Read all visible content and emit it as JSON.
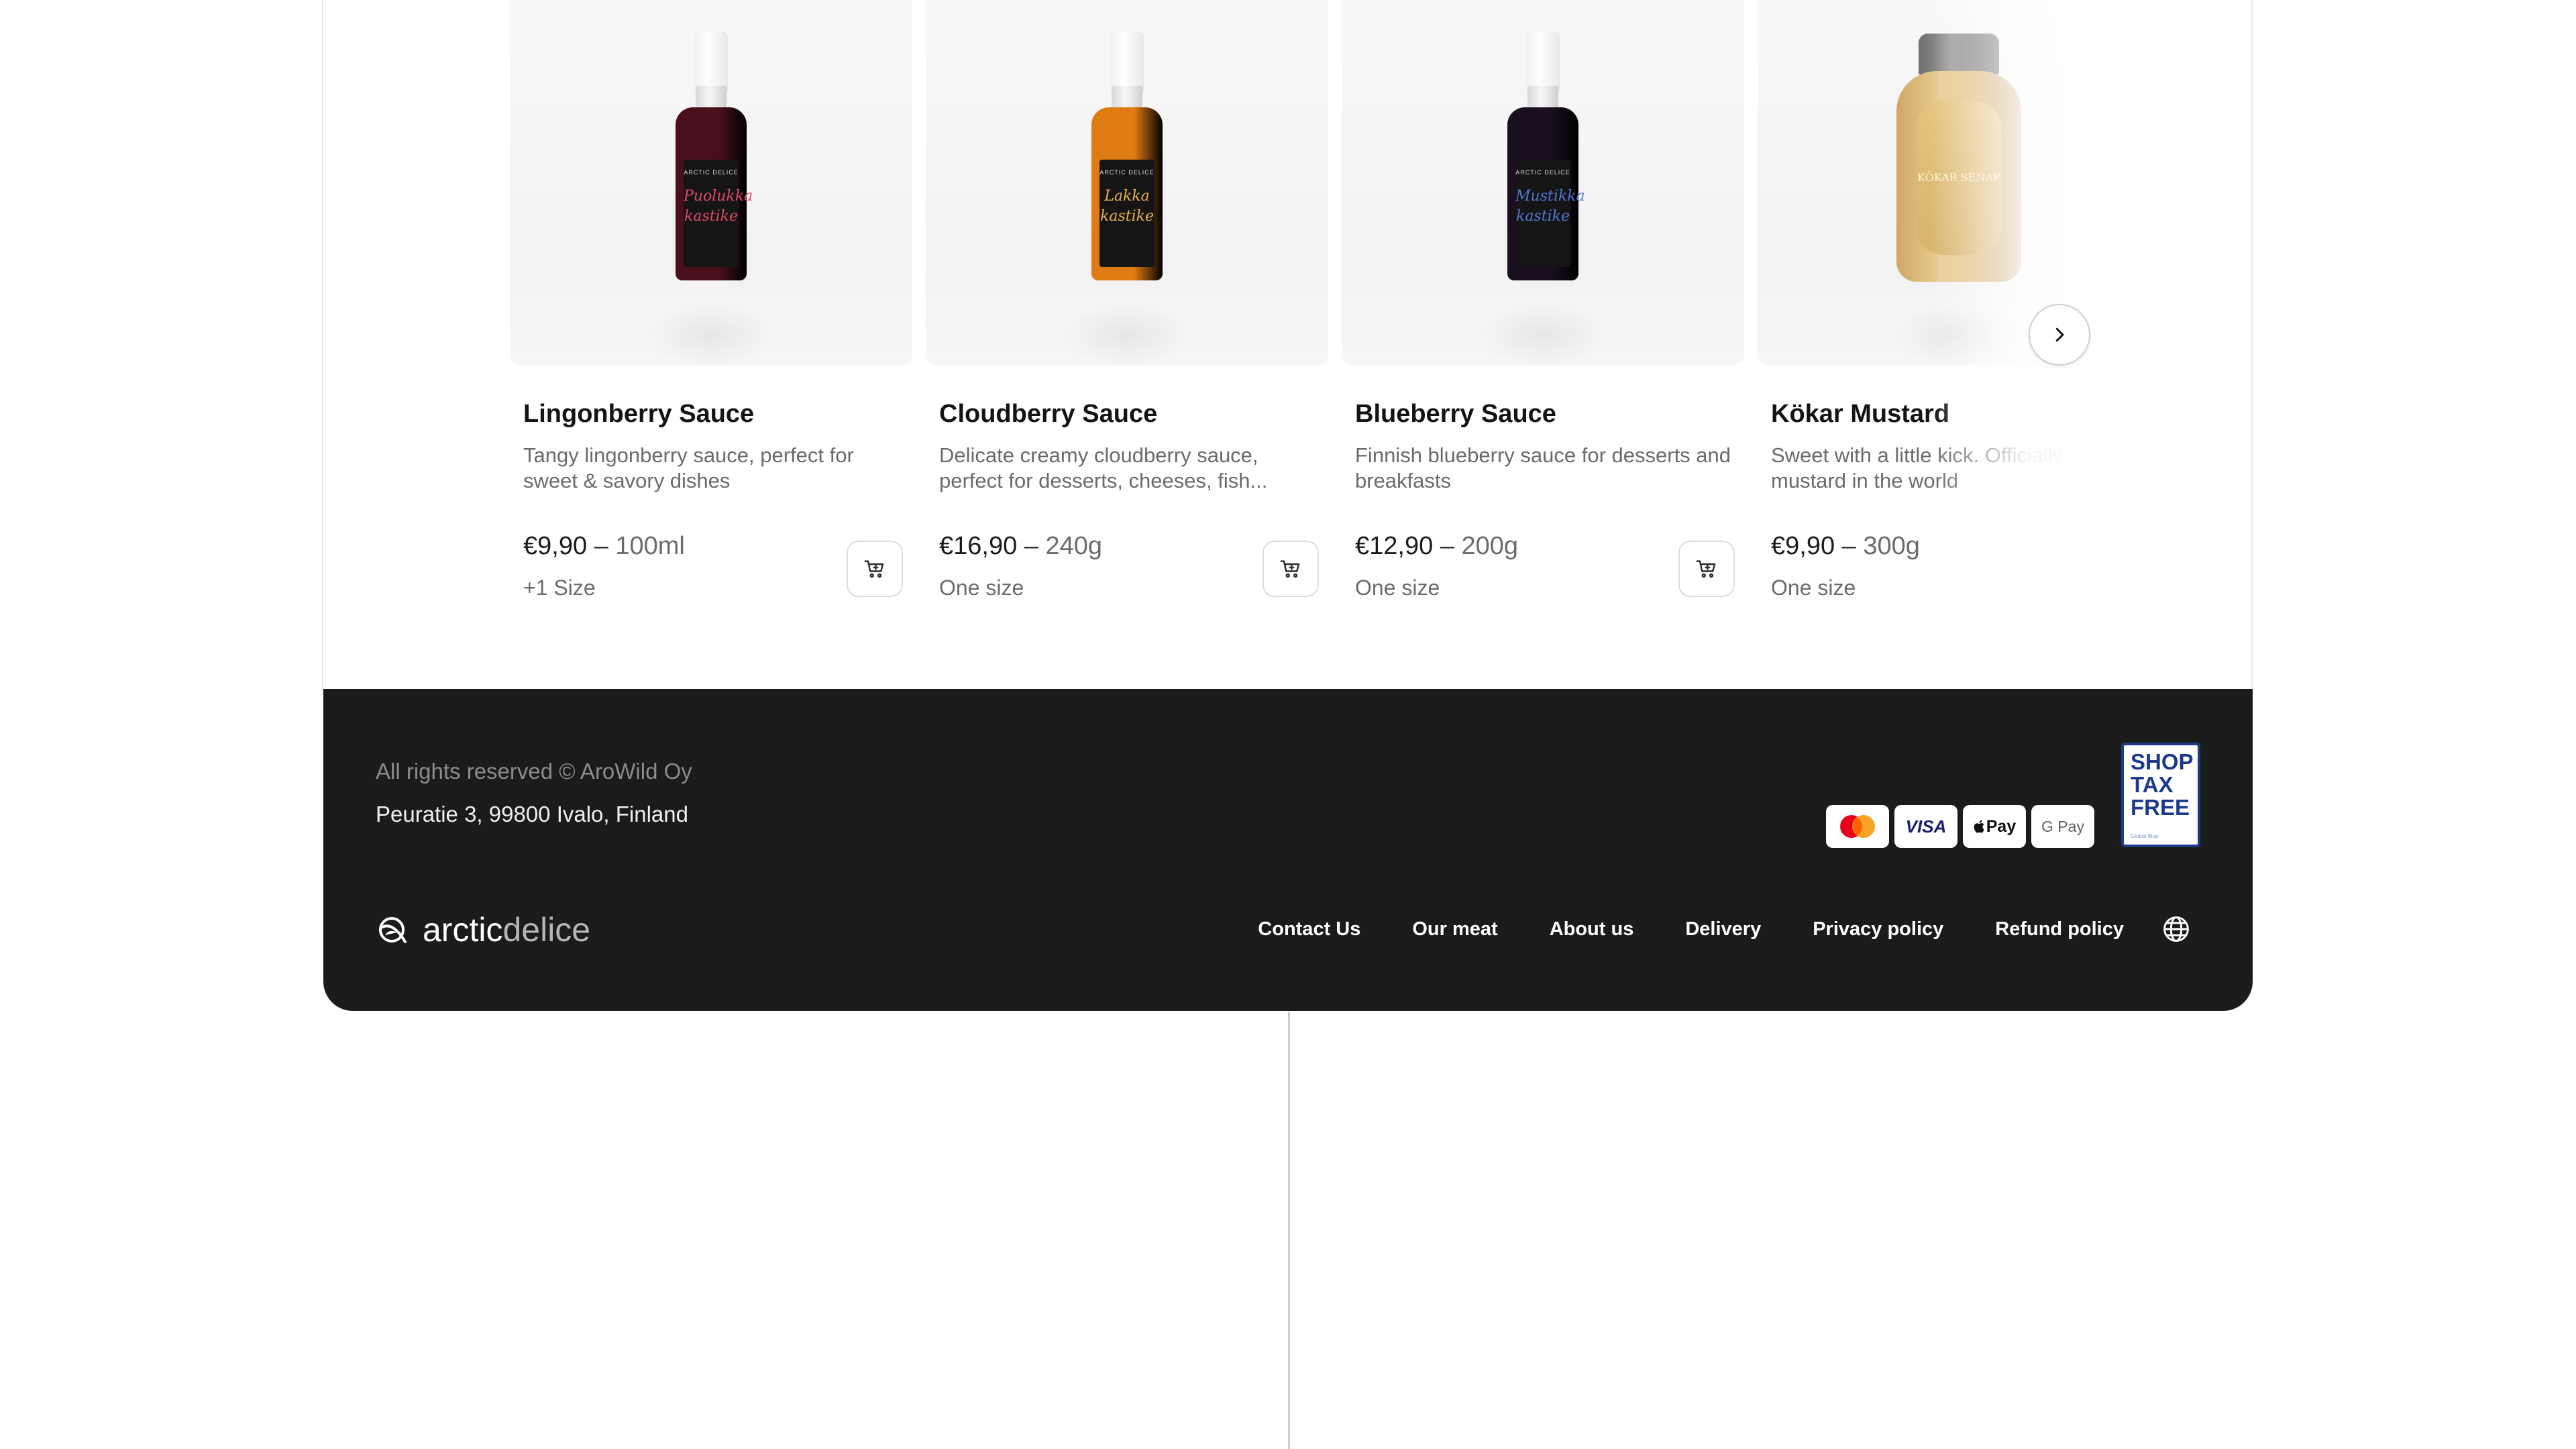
{
  "products": [
    {
      "name": "Lingonberry Sauce",
      "description": "Tangy lingonberry sauce, perfect for sweet & savory dishes",
      "price": "€9,90",
      "size": "100ml",
      "variant": "+1 Size",
      "label_brand": "ARCTIC DELICE",
      "label_script": "Puolukka kastike",
      "liquid_color": "#4a0f1c",
      "script_color": "#e0486a"
    },
    {
      "name": "Cloudberry Sauce",
      "description": "Delicate creamy cloudberry sauce, perfect for desserts, cheeses, fish...",
      "price": "€16,90",
      "size": "240g",
      "variant": "One size",
      "label_brand": "ARCTIC DELICE",
      "label_script": "Lakka kastike",
      "liquid_color": "#e07a12",
      "script_color": "#e9b24a"
    },
    {
      "name": "Blueberry Sauce",
      "description": "Finnish blueberry sauce for desserts and breakfasts",
      "price": "€12,90",
      "size": "200g",
      "variant": "One size",
      "label_brand": "ARCTIC DELICE",
      "label_script": "Mustikka kastike",
      "liquid_color": "#1a0f1f",
      "script_color": "#4f79d6"
    },
    {
      "name": "Kökar Mustard",
      "description": "Sweet with a little kick. Officially the best mustard in the world",
      "price": "€9,90",
      "size": "300g",
      "variant": "One size",
      "label_script": "KÖKAR SENAP"
    }
  ],
  "price_separator": "–",
  "footer": {
    "rights": "All rights reserved © AroWild Oy",
    "address": "Peuratie 3, 99800 Ivalo, Finland",
    "logo_word1": "arctic",
    "logo_word2": "delice",
    "links": [
      "Contact Us",
      "Our meat",
      "About us",
      "Delivery",
      "Privacy policy",
      "Refund policy"
    ],
    "payments": [
      "mastercard",
      "VISA",
      "Pay",
      "G Pay"
    ],
    "taxfree_lines": [
      "SHOP",
      "TAX",
      "FREE"
    ],
    "taxfree_sub": "Global Blue"
  },
  "colors": {
    "footer_bg": "#1b1b1b",
    "taxfree_blue": "#1d3a8a"
  },
  "icons": [
    "cart-icon",
    "chevron-right-icon",
    "globe-icon",
    "logo-mark-icon"
  ]
}
